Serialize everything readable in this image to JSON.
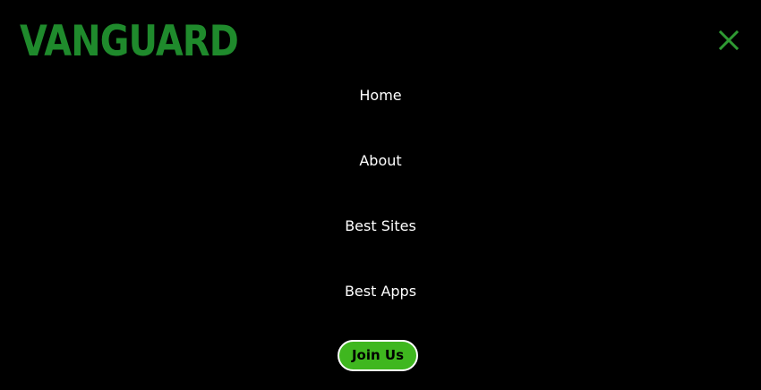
{
  "brand": {
    "logo_text": "VANGUARD",
    "logo_color": "#1f8a2c"
  },
  "header": {
    "close_icon": "close-icon",
    "close_color": "#2f9a33"
  },
  "menu": {
    "items": [
      {
        "label": "Home"
      },
      {
        "label": "About"
      },
      {
        "label": "Best Sites"
      },
      {
        "label": "Best Apps"
      }
    ],
    "join_label": "Join Us",
    "join_color": "#3fb71f"
  }
}
